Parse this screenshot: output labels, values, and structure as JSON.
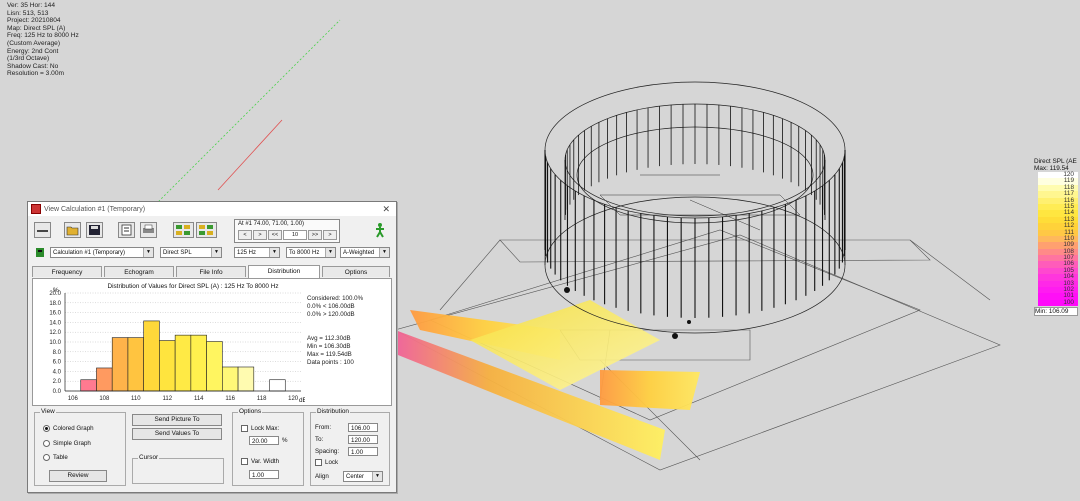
{
  "overlay_info": [
    "Ver: 35  Hor: 144",
    "Lisn: 513, 513",
    "Project: 20210804",
    "Map: Direct SPL (A)",
    "Freq: 125 Hz to 8000 Hz",
    "(Custom Average)",
    "Energy: 2nd Cont",
    "(1/3rd Octave)",
    "Shadow Cast: No",
    "Resolution = 3.00m"
  ],
  "legend": {
    "title": "Direct SPL (AE",
    "max": "Max: 119.54",
    "min": "Min: 106.09",
    "levels": [
      {
        "label": "120",
        "color": "#ffffff"
      },
      {
        "label": "119",
        "color": "#ffffe0"
      },
      {
        "label": "118",
        "color": "#fffcb0"
      },
      {
        "label": "117",
        "color": "#fff690"
      },
      {
        "label": "116",
        "color": "#fff070"
      },
      {
        "label": "115",
        "color": "#ffec55"
      },
      {
        "label": "114",
        "color": "#ffe640"
      },
      {
        "label": "113",
        "color": "#ffdd38"
      },
      {
        "label": "112",
        "color": "#ffd23a"
      },
      {
        "label": "111",
        "color": "#ffc845"
      },
      {
        "label": "110",
        "color": "#ffb85c"
      },
      {
        "label": "109",
        "color": "#ffa070"
      },
      {
        "label": "108",
        "color": "#ff8a88"
      },
      {
        "label": "107",
        "color": "#ff74a0"
      },
      {
        "label": "106",
        "color": "#ff5cba"
      },
      {
        "label": "105",
        "color": "#ff48cf"
      },
      {
        "label": "104",
        "color": "#ff36dd"
      },
      {
        "label": "103",
        "color": "#ff28e8"
      },
      {
        "label": "102",
        "color": "#ff1cf0"
      },
      {
        "label": "101",
        "color": "#ff10f6"
      },
      {
        "label": "100",
        "color": "#ff08fb"
      }
    ]
  },
  "dialog": {
    "title": "View Calculation #1 (Temporary)",
    "close": "✕",
    "readout": {
      "line1": "At #1   74.00, 71.00, 1.00)",
      "nav": [
        "<",
        ">",
        "<<",
        "10",
        ">>",
        ">"
      ]
    },
    "selectors": {
      "calculation": "Calculation #1 (Temporary)",
      "map": "Direct SPL",
      "freq_from": "125 Hz",
      "freq_to": "To 8000 Hz",
      "weighting": "A-Weighted"
    },
    "tabs": [
      "Frequency",
      "Echogram",
      "File Info",
      "Distribution",
      "Options"
    ],
    "active_tab": "Distribution",
    "stats": {
      "considered": "Considered: 100.0%",
      "below": "0.0% < 106.00dB",
      "above": "0.0% > 120.00dB",
      "avg": "Avg = 112.30dB",
      "min": "Min = 106.30dB",
      "max": "Max = 119.54dB",
      "points": "Data points : 100"
    },
    "view_group": {
      "title": "View",
      "options": [
        "Colored Graph",
        "Simple Graph",
        "Table"
      ],
      "selected": "Colored Graph",
      "review": "Review"
    },
    "send_picture": "Send Picture To",
    "send_values": "Send Values To",
    "cursor_group": "Cursor",
    "options_group": {
      "title": "Options",
      "lock_max": "Lock Max:",
      "lock_max_value": "20.00",
      "lock_max_unit": "%",
      "bar_width": "Var. Width",
      "bar_width_value": "1.00"
    },
    "distribution_group": {
      "title": "Distribution",
      "from_label": "From:",
      "from_value": "106.00",
      "to_label": "To:",
      "to_value": "120.00",
      "spacing_label": "Spacing:",
      "spacing_value": "1.00",
      "lock": "Lock",
      "align_label": "Align",
      "align_value": "Center"
    }
  },
  "chart_data": {
    "type": "bar",
    "title": "Distribution of Values for Direct SPL (A) : 125 Hz To 8000 Hz",
    "ylabel": "%",
    "xlabel": "dB",
    "x": [
      106,
      107,
      108,
      109,
      110,
      111,
      112,
      113,
      114,
      115,
      116,
      117,
      118,
      119
    ],
    "values": [
      0,
      2.3,
      4.7,
      10.9,
      10.9,
      14.3,
      10.3,
      11.4,
      11.4,
      10.1,
      4.9,
      4.9,
      0,
      2.3,
      0
    ],
    "ylim": [
      0,
      20
    ],
    "yticks": [
      "0.0",
      "2.0",
      "4.0",
      "6.0",
      "8.0",
      "10.0",
      "12.0",
      "14.0",
      "16.0",
      "18.0",
      "20.0"
    ],
    "xticks": [
      "106",
      "108",
      "110",
      "112",
      "114",
      "116",
      "118",
      "120"
    ]
  }
}
